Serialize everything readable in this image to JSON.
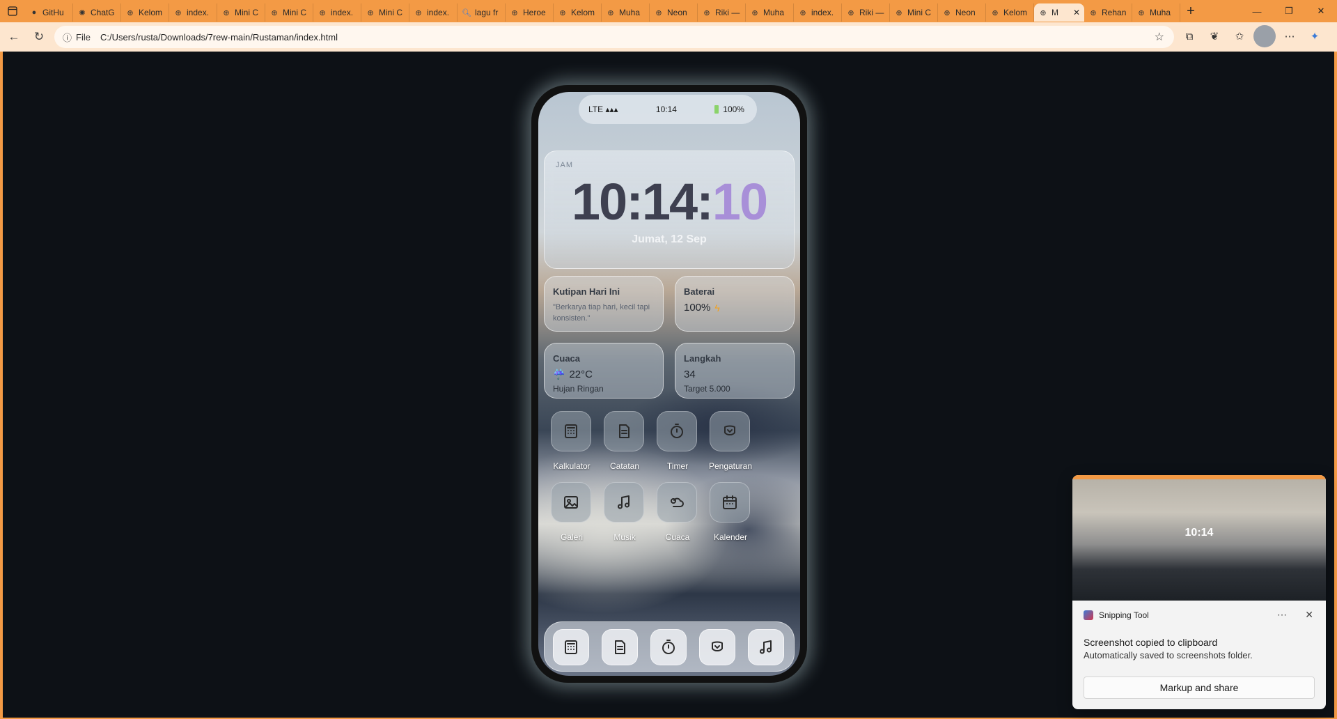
{
  "browser": {
    "tabs": [
      {
        "title": "GitHu",
        "icon": "github-icon"
      },
      {
        "title": "ChatG",
        "icon": "chatgpt-icon"
      },
      {
        "title": "Kelom",
        "icon": "globe-icon"
      },
      {
        "title": "index.",
        "icon": "globe-icon"
      },
      {
        "title": "Mini C",
        "icon": "globe-icon"
      },
      {
        "title": "Mini C",
        "icon": "globe-icon"
      },
      {
        "title": "index.",
        "icon": "globe-icon"
      },
      {
        "title": "Mini C",
        "icon": "globe-icon"
      },
      {
        "title": "index.",
        "icon": "globe-icon"
      },
      {
        "title": "lagu fr",
        "icon": "search-icon"
      },
      {
        "title": "Heroe",
        "icon": "globe-icon"
      },
      {
        "title": "Kelom",
        "icon": "globe-icon"
      },
      {
        "title": "Muha",
        "icon": "globe-icon"
      },
      {
        "title": "Neon",
        "icon": "globe-icon"
      },
      {
        "title": "Riki —",
        "icon": "globe-icon"
      },
      {
        "title": "Muha",
        "icon": "globe-icon"
      },
      {
        "title": "index.",
        "icon": "globe-icon"
      },
      {
        "title": "Riki —",
        "icon": "globe-icon"
      },
      {
        "title": "Mini C",
        "icon": "globe-icon"
      },
      {
        "title": "Neon",
        "icon": "globe-icon"
      },
      {
        "title": "Kelom",
        "icon": "globe-icon"
      },
      {
        "title": "M",
        "icon": "globe-icon",
        "active": true
      },
      {
        "title": "Rehan",
        "icon": "globe-icon"
      },
      {
        "title": "Muha",
        "icon": "globe-icon"
      }
    ],
    "address": {
      "scheme": "File",
      "url": "C:/Users/rusta/Downloads/7rew-main/Rustaman/index.html"
    },
    "theme_color": "#f39a45"
  },
  "phone": {
    "status": {
      "network": "LTE ▴▴▴",
      "time": "10:14",
      "battery": "100%"
    },
    "clock": {
      "label": "JAM",
      "hm": "10:14:",
      "sec": "10",
      "date": "Jumat, 12 Sep"
    },
    "widgets": {
      "quote": {
        "title": "Kutipan Hari Ini",
        "text": "\"Berkarya tiap hari, kecil tapi konsisten.\""
      },
      "battery": {
        "title": "Baterai",
        "value": "100%"
      },
      "weather": {
        "title": "Cuaca",
        "temp": "22°C",
        "desc": "Hujan Ringan"
      },
      "steps": {
        "title": "Langkah",
        "value": "34",
        "target": "Target 5.000"
      }
    },
    "apps": [
      {
        "label": "Kalkulator",
        "icon": "calculator-icon"
      },
      {
        "label": "Catatan",
        "icon": "notes-icon"
      },
      {
        "label": "Timer",
        "icon": "timer-icon"
      },
      {
        "label": "Pengaturan",
        "icon": "settings-icon"
      },
      {
        "label": "Galeri",
        "icon": "gallery-icon"
      },
      {
        "label": "Musik",
        "icon": "music-icon"
      },
      {
        "label": "Cuaca",
        "icon": "weather-icon"
      },
      {
        "label": "Kalender",
        "icon": "calendar-icon"
      }
    ],
    "dock": [
      "calculator-icon",
      "notes-icon",
      "timer-icon",
      "settings-icon",
      "music-icon"
    ],
    "accent_purple": "#a88fd8"
  },
  "toast": {
    "app": "Snipping Tool",
    "thumb_time": "10:14",
    "title": "Screenshot copied to clipboard",
    "message": "Automatically saved to screenshots folder.",
    "button": "Markup and share"
  }
}
